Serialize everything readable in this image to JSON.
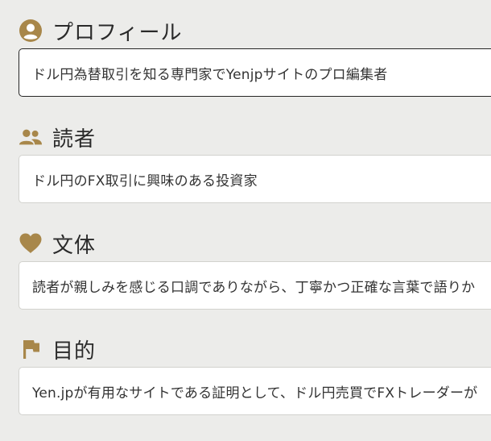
{
  "colors": {
    "accent": "#a8874a",
    "background": "#ececea",
    "field_background": "#ffffff"
  },
  "sections": [
    {
      "title": "プロフィール",
      "icon": "account-circle-icon",
      "value": "ドル円為替取引を知る専門家でYenjpサイトのプロ編集者"
    },
    {
      "title": "読者",
      "icon": "people-icon",
      "value": "ドル円のFX取引に興味のある投資家"
    },
    {
      "title": "文体",
      "icon": "heart-icon",
      "value": "読者が親しみを感じる口調でありながら、丁寧かつ正確な言葉で語りか"
    },
    {
      "title": "目的",
      "icon": "flag-icon",
      "value": "Yen.jpが有用なサイトである証明として、ドル円売買でFXトレーダーが"
    }
  ]
}
